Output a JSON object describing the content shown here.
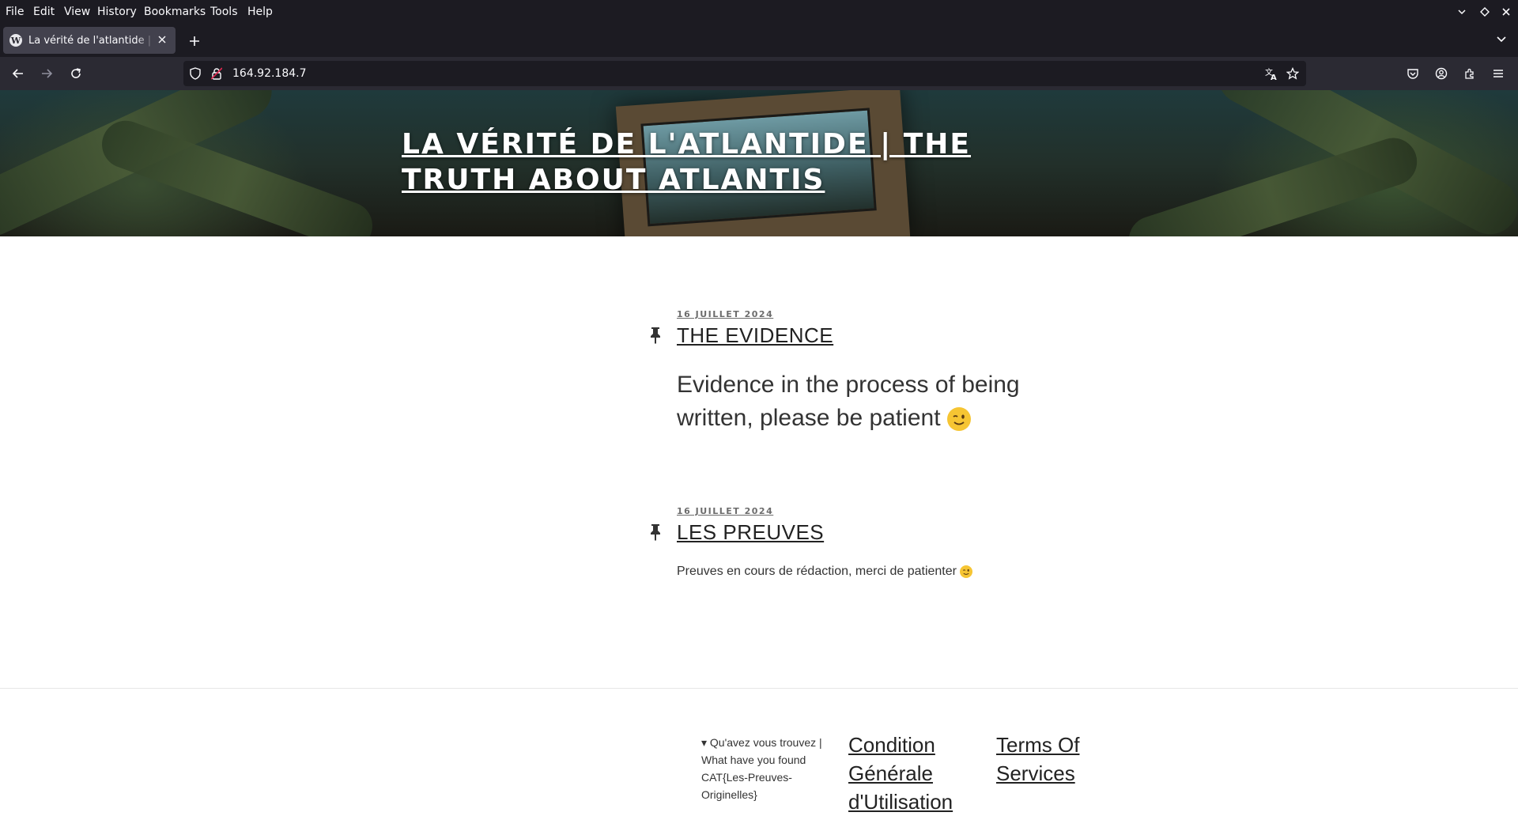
{
  "menubar": {
    "items": [
      "File",
      "Edit",
      "View",
      "History",
      "Bookmarks",
      "Tools",
      "Help"
    ]
  },
  "tab": {
    "title": "La vérité de l'atlantide | The Truth About Atlantis",
    "favicon": "wordpress-icon"
  },
  "address": {
    "url": "164.92.184.7"
  },
  "site": {
    "title": "La vérité de l'atlantide | The Truth About Atlantis"
  },
  "posts": [
    {
      "date": "16 juillet 2024",
      "title": "The Evidence",
      "body": "Evidence in the process of being written, please be patient"
    },
    {
      "date": "16 juillet 2024",
      "title": "Les preuves",
      "body": "Preuves en cours de rédaction, merci de patienter"
    }
  ],
  "footer": {
    "widget_text": "▾ Qu'avez vous trouvez | What have you found CAT{Les-Preuves-Originelles}",
    "links": [
      "Condition Générale d'Utilisation",
      "Terms Of Services"
    ]
  },
  "colors": {
    "chrome_dark": "#1c1b22",
    "chrome": "#2b2a33",
    "text_dark": "#222222"
  }
}
